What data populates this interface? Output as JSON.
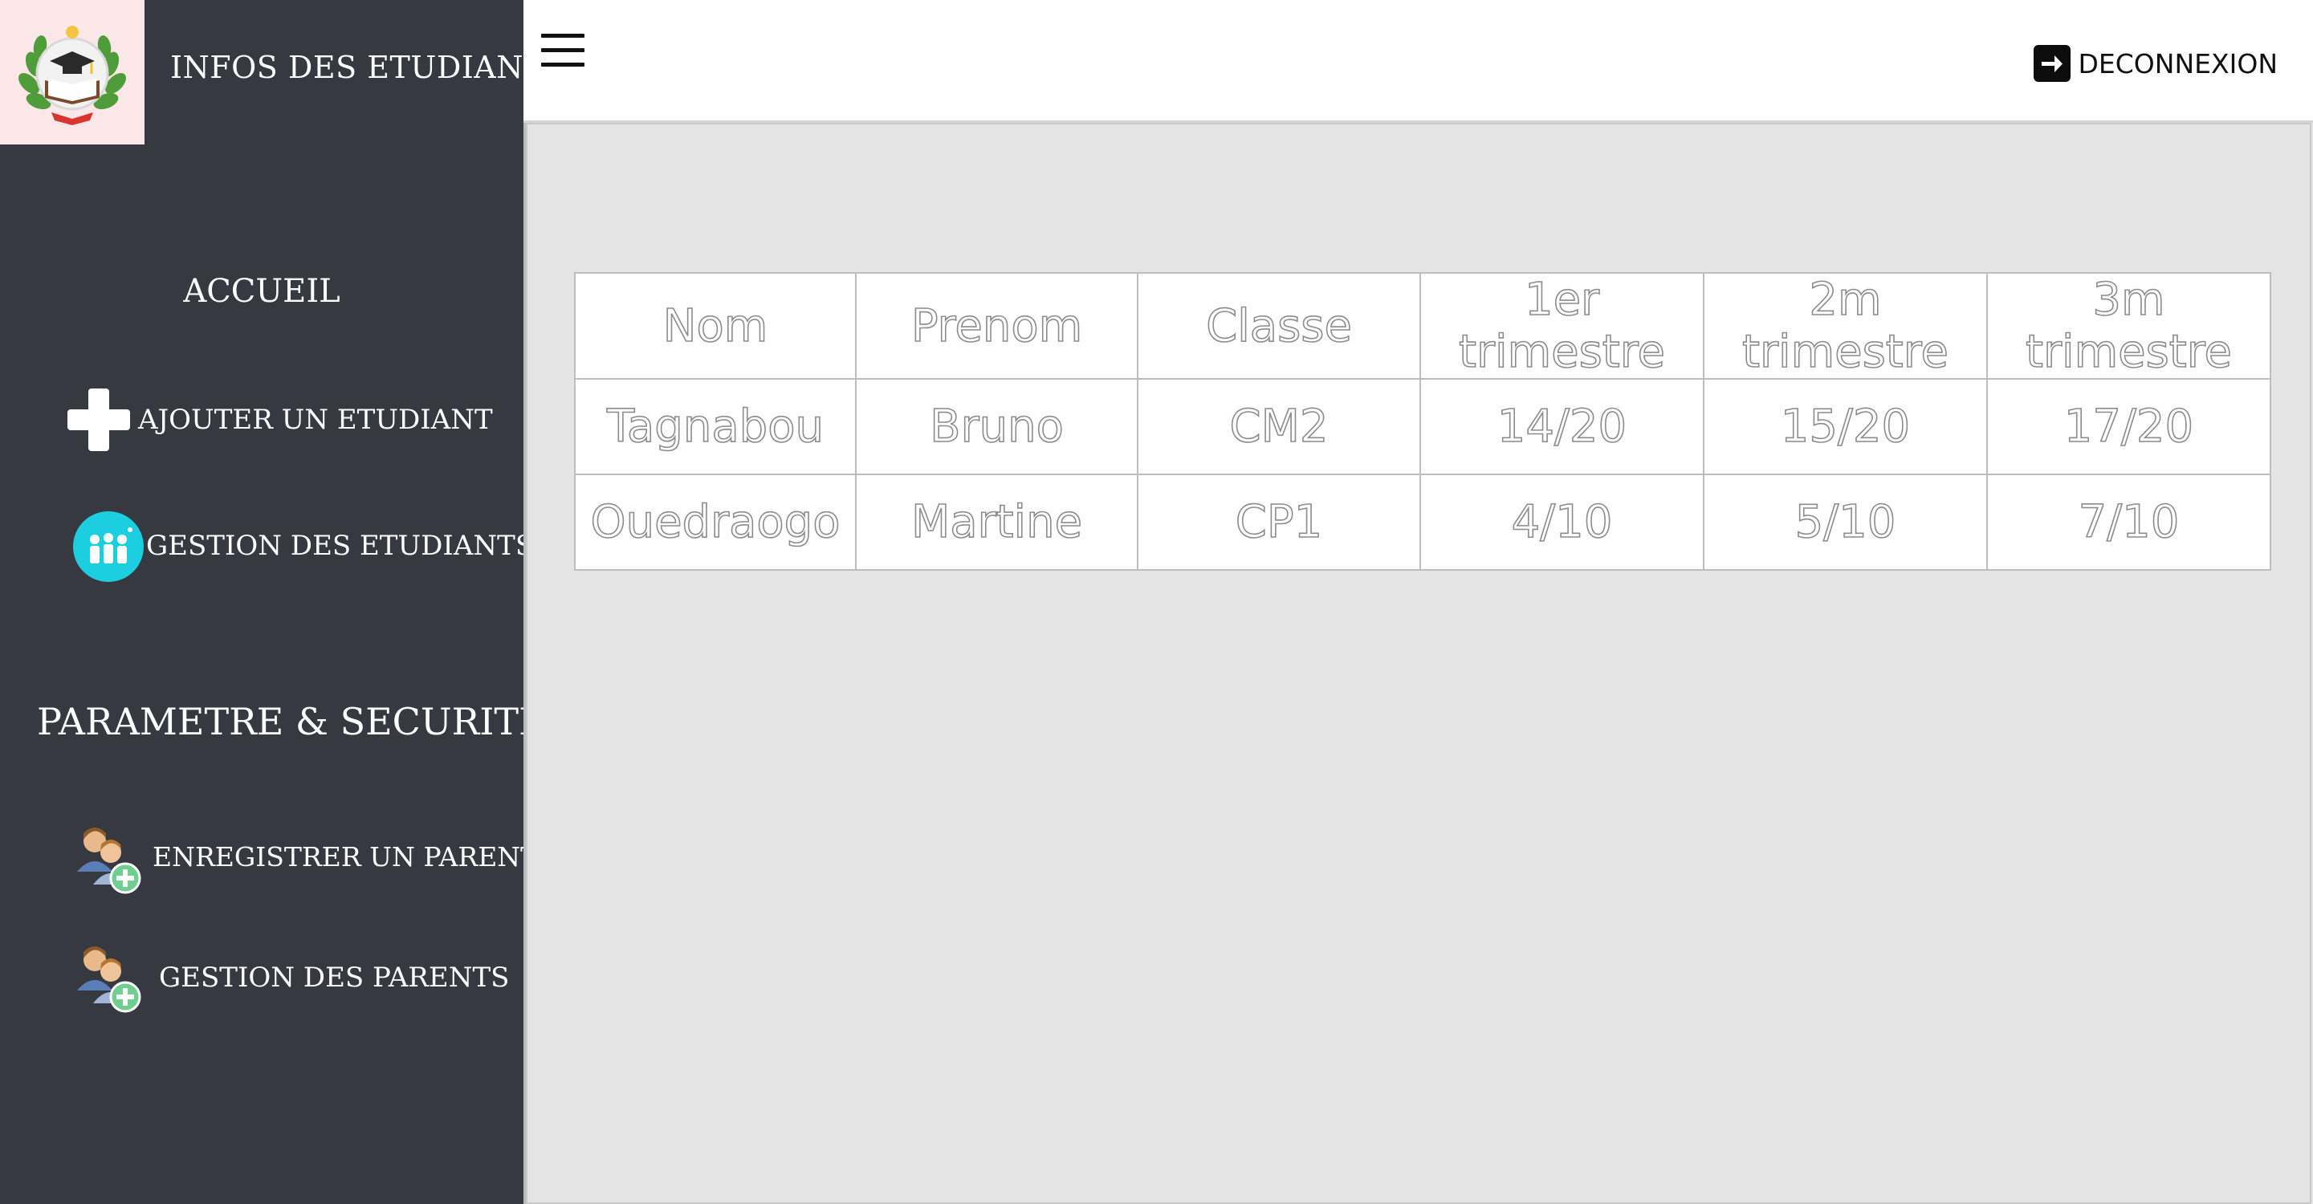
{
  "sidebar": {
    "app_title": "INFOS DES ETUDIANTS",
    "home_label": "ACCUEIL",
    "items": [
      {
        "label": "AJOUTER UN ETUDIANT",
        "icon": "plus-icon"
      },
      {
        "label": "GESTION DES ETUDIANTS",
        "icon": "students-group-icon"
      }
    ],
    "section_title": "PARAMETRE & SECURITE",
    "settings_items": [
      {
        "label": "ENREGISTRER UN PARENT",
        "icon": "add-parent-icon"
      },
      {
        "label": "GESTION DES PARENTS",
        "icon": "manage-parents-icon"
      }
    ]
  },
  "topbar": {
    "logout_label": "DECONNEXION"
  },
  "table": {
    "headers": [
      "Nom",
      "Prenom",
      "Classe",
      "1er trimestre",
      "2m trimestre",
      "3m trimestre"
    ],
    "rows": [
      [
        "Tagnabou",
        "Bruno",
        "CM2",
        "14/20",
        "15/20",
        "17/20"
      ],
      [
        "Ouedraogo",
        "Martine",
        "CP1",
        "4/10",
        "5/10",
        "7/10"
      ]
    ]
  },
  "colors": {
    "sidebar_bg": "#363a40",
    "main_bg": "#e4e4e4",
    "logo_bg": "#fbe7e7",
    "accent_cyan": "#1ccfe0"
  }
}
